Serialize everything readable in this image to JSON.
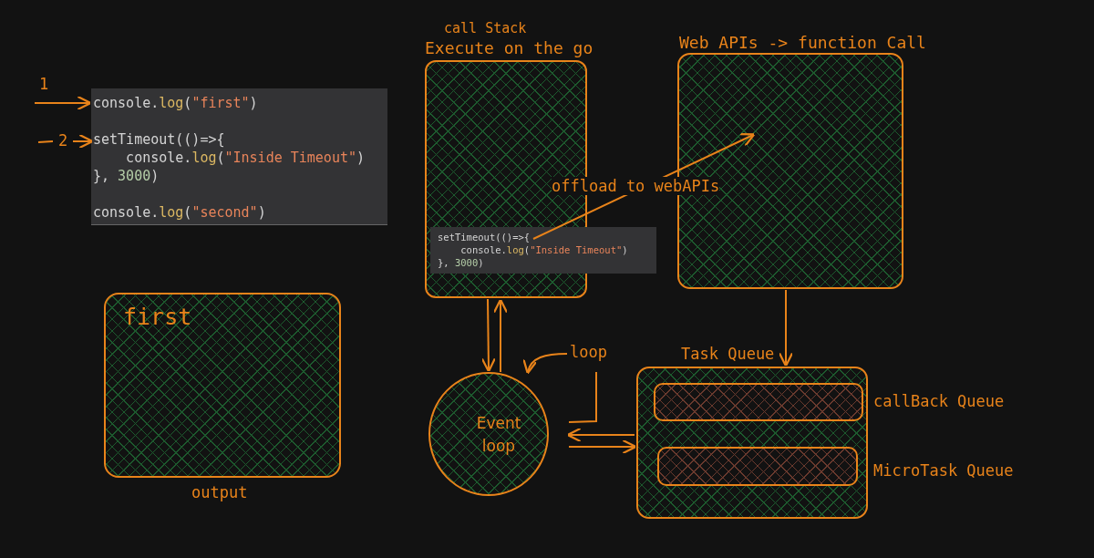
{
  "step_markers": [
    "1",
    "2"
  ],
  "code_panels": [
    {
      "kind": "large",
      "lines": [
        [
          {
            "kind": "plain",
            "text": "console."
          },
          {
            "kind": "fn",
            "text": "log"
          },
          {
            "kind": "plain",
            "text": "("
          },
          {
            "kind": "string",
            "text": "\"first\""
          },
          {
            "kind": "plain",
            "text": ")"
          }
        ],
        [
          {
            "kind": "plain",
            "text": "setTimeout(()=>{"
          }
        ],
        [
          {
            "kind": "plain",
            "text": "    console."
          },
          {
            "kind": "fn",
            "text": "log"
          },
          {
            "kind": "plain",
            "text": "("
          },
          {
            "kind": "string",
            "text": "\"Inside Timeout\""
          },
          {
            "kind": "plain",
            "text": ")"
          }
        ],
        [
          {
            "kind": "plain",
            "text": "}, "
          },
          {
            "kind": "number",
            "text": "3000"
          },
          {
            "kind": "plain",
            "text": ")"
          }
        ],
        [
          {
            "kind": "plain",
            "text": "console."
          },
          {
            "kind": "fn",
            "text": "log"
          },
          {
            "kind": "plain",
            "text": "("
          },
          {
            "kind": "string",
            "text": "\"second\""
          },
          {
            "kind": "plain",
            "text": ")"
          }
        ]
      ],
      "blank_before": [
        false,
        true,
        false,
        false,
        true
      ]
    },
    {
      "kind": "small",
      "lines": [
        [
          {
            "kind": "plain",
            "text": "setTimeout(()=>{"
          }
        ],
        [
          {
            "kind": "plain",
            "text": "    console."
          },
          {
            "kind": "fn",
            "text": "log"
          },
          {
            "kind": "plain",
            "text": "("
          },
          {
            "kind": "string",
            "text": "\"Inside Timeout\""
          },
          {
            "kind": "plain",
            "text": ")"
          }
        ],
        [
          {
            "kind": "plain",
            "text": "}, "
          },
          {
            "kind": "number",
            "text": "3000"
          },
          {
            "kind": "plain",
            "text": ")"
          }
        ]
      ],
      "blank_before": [
        false,
        false,
        false
      ]
    }
  ],
  "call_stack": {
    "caption": "call Stack",
    "title": "Execute on the go"
  },
  "web_apis": {
    "title": "Web APIs -> function Call"
  },
  "offload_label": "offload to webAPIs",
  "output": {
    "content": "first",
    "caption": "output"
  },
  "event_loop": {
    "lines": [
      "Event",
      "loop"
    ]
  },
  "loop_label": "loop",
  "task_queue": {
    "title": "Task Queue",
    "queues": [
      {
        "label": "callBack Queue"
      },
      {
        "label": "MicroTask Queue"
      }
    ]
  }
}
